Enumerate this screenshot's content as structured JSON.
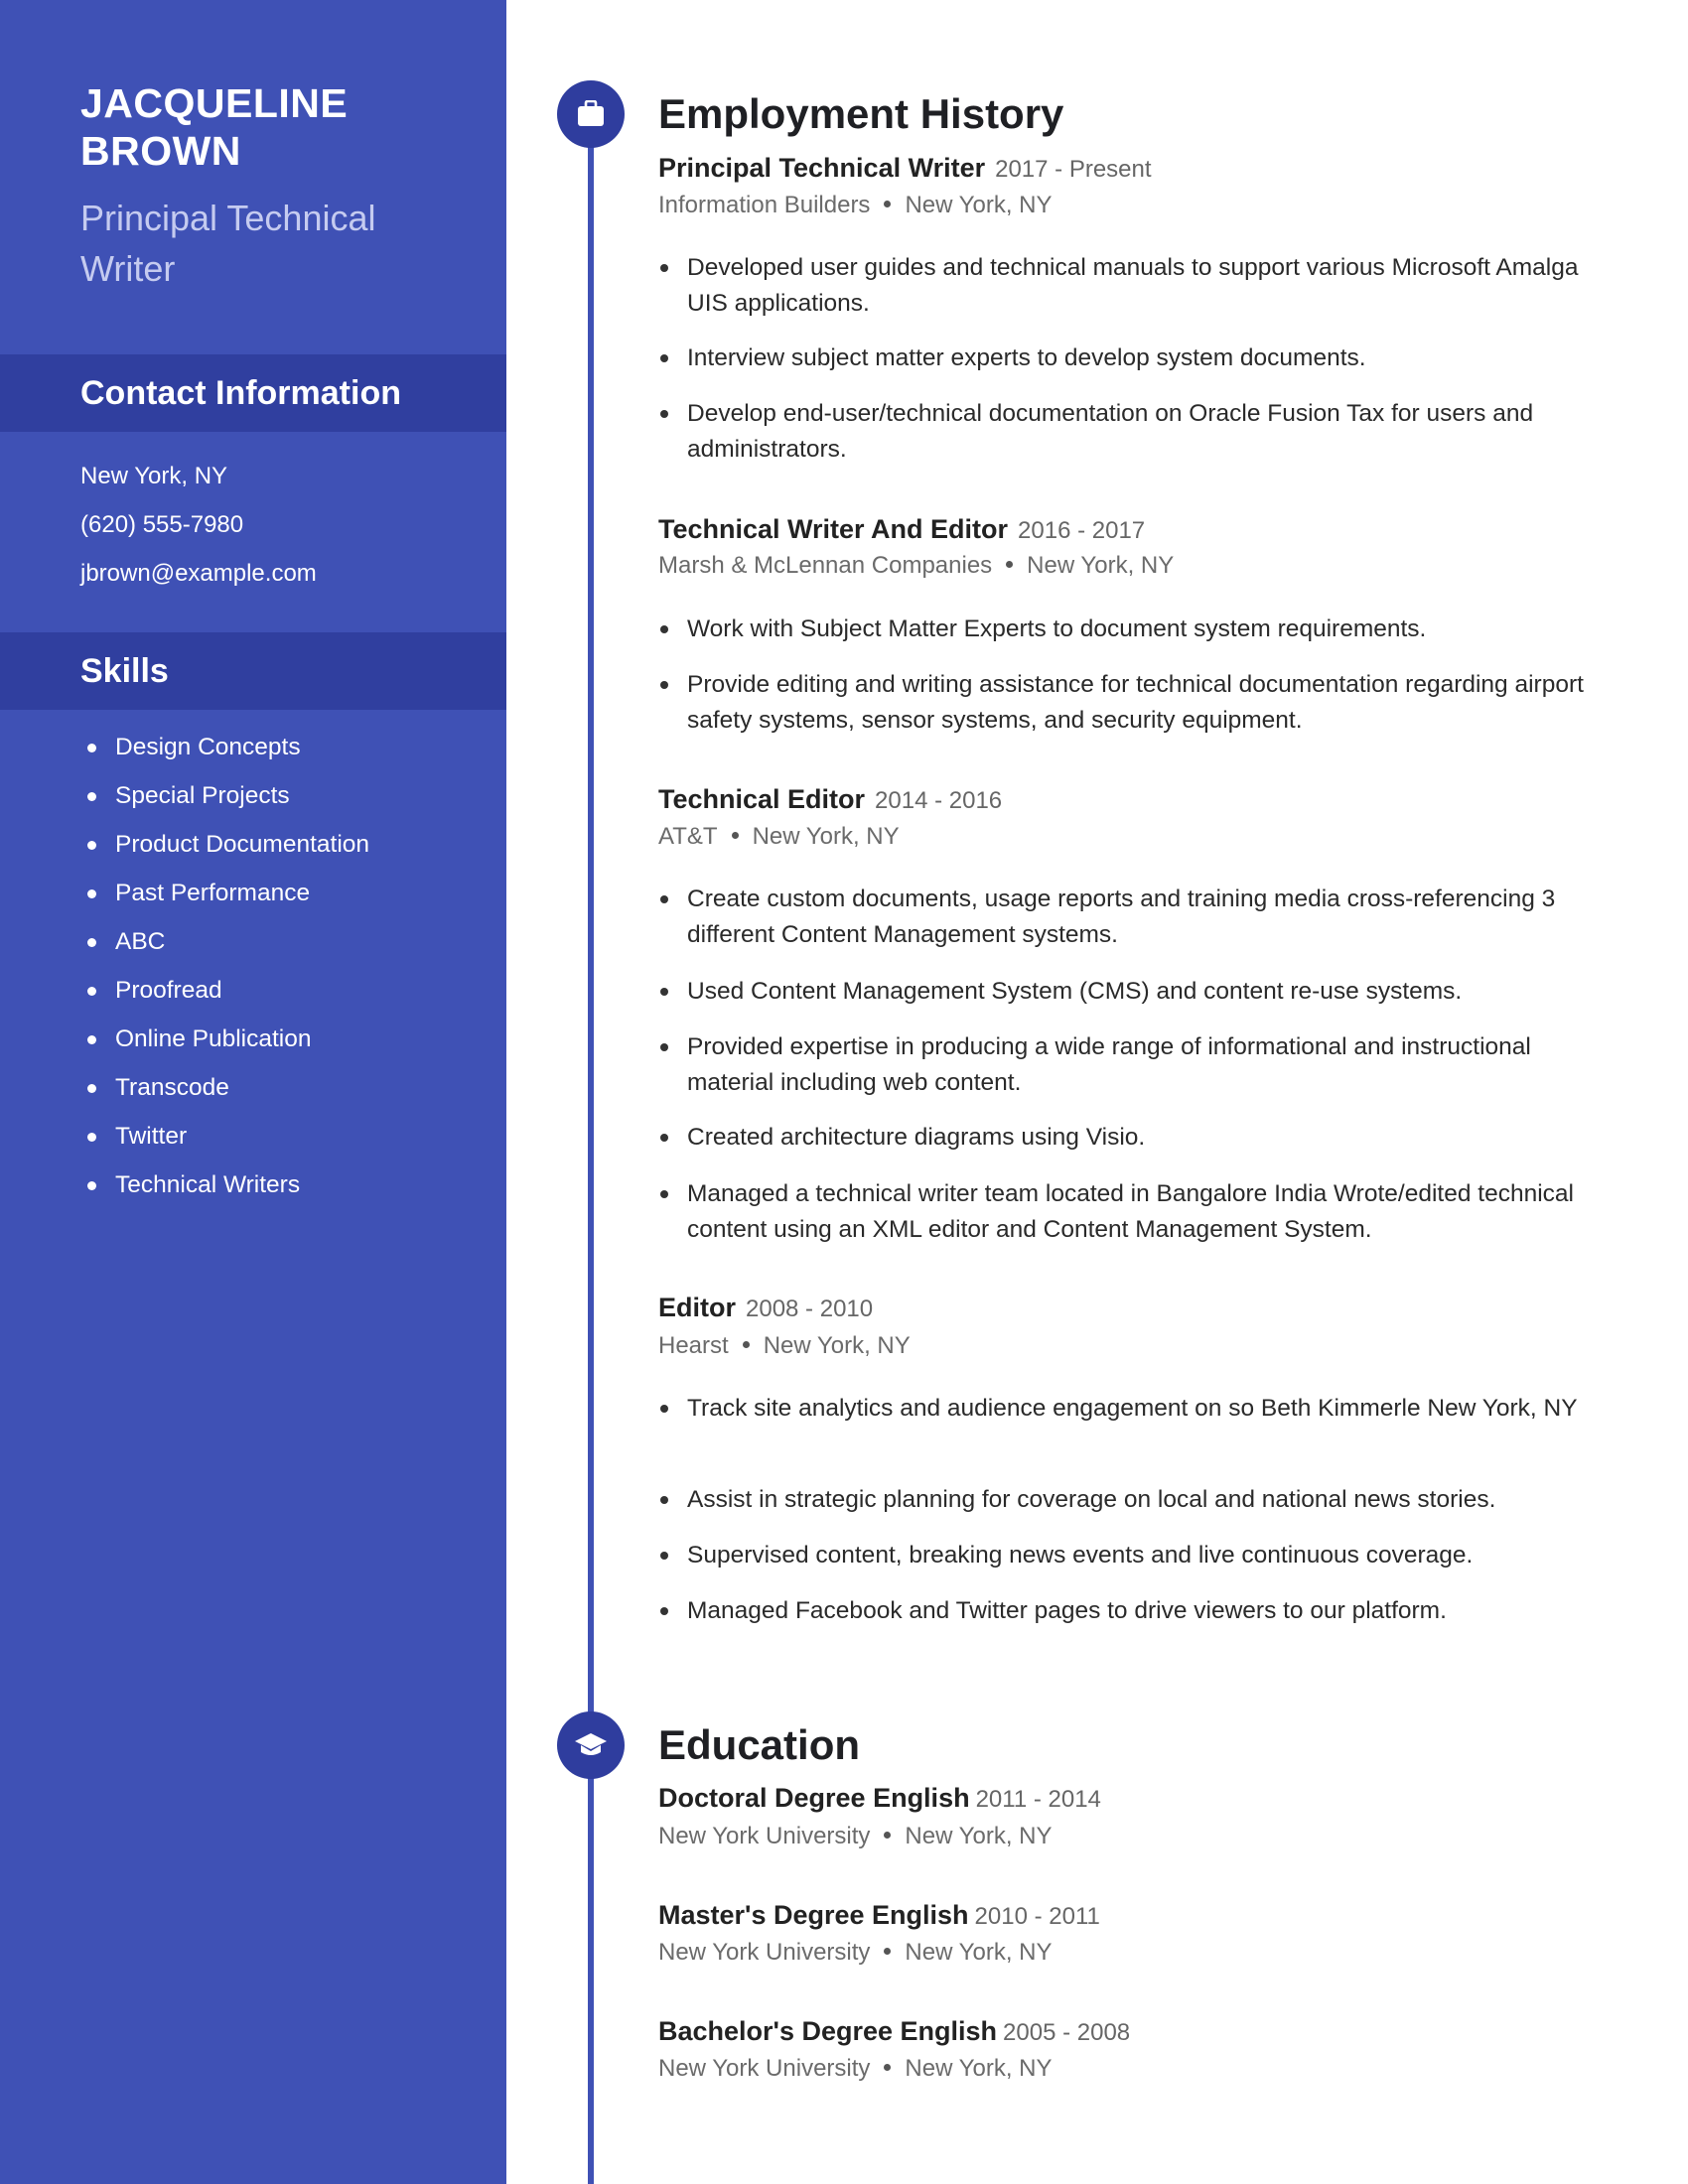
{
  "profile": {
    "name_line1": "JACQUELINE",
    "name_line2": "BROWN",
    "title_line1": "Principal Technical",
    "title_line2": "Writer"
  },
  "contact": {
    "heading": "Contact Information",
    "location": "New York, NY",
    "phone": "(620) 555-7980",
    "email": "jbrown@example.com"
  },
  "skills": {
    "heading": "Skills",
    "items": [
      "Design Concepts",
      "Special Projects",
      "Product Documentation",
      "Past Performance",
      "ABC",
      "Proofread",
      "Online Publication",
      "Transcode",
      "Twitter",
      "Technical Writers"
    ]
  },
  "employment": {
    "heading": "Employment History",
    "icon": "briefcase-icon",
    "jobs": [
      {
        "title": "Principal Technical Writer",
        "dates": "2017 - Present",
        "company": "Information Builders",
        "location": "New York, NY",
        "bullets": [
          "Developed user guides and technical manuals to support various Microsoft Amalga UIS applications.",
          "Interview subject matter experts to develop system documents.",
          "Develop end-user/technical documentation on Oracle Fusion Tax for users and administrators."
        ]
      },
      {
        "title": "Technical Writer And Editor",
        "dates": "2016 - 2017",
        "company": "Marsh & McLennan Companies",
        "location": "New York, NY",
        "bullets": [
          "Work with Subject Matter Experts to document system requirements.",
          "Provide editing and writing assistance for technical documentation regarding airport safety systems, sensor systems, and security equipment."
        ]
      },
      {
        "title": "Technical Editor",
        "dates": "2014 - 2016",
        "company": "AT&T",
        "location": "New York, NY",
        "bullets": [
          "Create custom documents, usage reports and training media cross-referencing 3 different Content Management systems.",
          "Used Content Management System (CMS) and content re-use systems.",
          "Provided expertise in producing a wide range of informational and instructional material including web content.",
          "Created architecture diagrams using Visio.",
          "Managed a technical writer team located in Bangalore India Wrote/edited technical content using an XML editor and Content Management System."
        ]
      },
      {
        "title": "Editor",
        "dates": "2008 - 2010",
        "company": "Hearst",
        "location": "New York, NY",
        "bullets": [
          "Track site analytics and audience engagement on so Beth Kimmerle New York, NY",
          "Assist in strategic planning for coverage on local and national news stories.",
          "Supervised content, breaking news events and live continuous coverage.",
          "Managed Facebook and Twitter pages to drive viewers to our platform."
        ]
      }
    ]
  },
  "education": {
    "heading": "Education",
    "icon": "graduation-cap-icon",
    "entries": [
      {
        "degree": "Doctoral Degree English",
        "dates": "2011 - 2014",
        "school": "New York University",
        "location": "New York, NY"
      },
      {
        "degree": "Master's Degree English",
        "dates": "2010 - 2011",
        "school": "New York University",
        "location": "New York, NY"
      },
      {
        "degree": "Bachelor's Degree English",
        "dates": "2005 - 2008",
        "school": "New York University",
        "location": "New York, NY"
      }
    ]
  },
  "colors": {
    "sidebar": "#3f51b5",
    "sidebar_band": "#303f9f",
    "accent": "#3f51b5",
    "node": "#2f3d9e",
    "heading_text": "#1f2024",
    "muted_text": "#6b6b6b"
  }
}
